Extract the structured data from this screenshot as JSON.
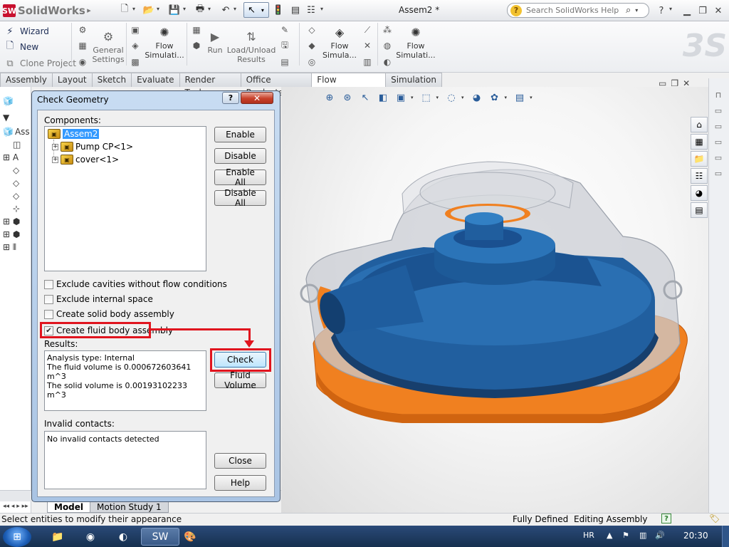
{
  "app": {
    "name": "SolidWorks",
    "document_title": "Assem2 *",
    "help_search_placeholder": "Search SolidWorks Help"
  },
  "command_manager": {
    "left_items": [
      {
        "label": "Wizard",
        "icon": "wizard-icon"
      },
      {
        "label": "New",
        "icon": "new-project-icon"
      },
      {
        "label": "Clone Project",
        "icon": "clone-project-icon"
      }
    ],
    "general_settings": "General Settings",
    "flow_simulation_1": "Flow Simulati...",
    "run": "Run",
    "load_unload_results": "Load/Unload Results",
    "flow_simulation_2": "Flow Simula...",
    "flow_simulation_3": "Flow Simulati..."
  },
  "tabs": [
    {
      "label": "Assembly",
      "active": false
    },
    {
      "label": "Layout",
      "active": false
    },
    {
      "label": "Sketch",
      "active": false
    },
    {
      "label": "Evaluate",
      "active": false
    },
    {
      "label": "Render Tools",
      "active": false
    },
    {
      "label": "Office Products",
      "active": false
    },
    {
      "label": "Flow Simulation",
      "active": true
    },
    {
      "label": "Simulation",
      "active": false
    }
  ],
  "feature_tree": {
    "top_item_partial": "Ass"
  },
  "dialog": {
    "title": "Check Geometry",
    "help_button": "?",
    "close_button": "✕",
    "components_label": "Components:",
    "tree": {
      "root": "Assem2",
      "children": [
        "Pump CP<1>",
        "cover<1>"
      ]
    },
    "buttons": {
      "enable": "Enable",
      "disable": "Disable",
      "enable_all": "Enable All",
      "disable_all": "Disable All",
      "check": "Check",
      "fluid_volume": "Fluid Volume",
      "close": "Close",
      "help": "Help"
    },
    "options": [
      {
        "label": "Exclude cavities without flow conditions",
        "checked": false
      },
      {
        "label": "Exclude internal space",
        "checked": false
      },
      {
        "label": "Create solid body assembly",
        "checked": false
      },
      {
        "label": "Create fluid body assembly",
        "checked": true
      }
    ],
    "results_label": "Results:",
    "results": [
      "Analysis type: Internal",
      "The fluid volume is 0.000672603641 m^3",
      "The solid volume is 0.00193102233 m^3"
    ],
    "invalid_contacts_label": "Invalid contacts:",
    "invalid_contacts": "No invalid contacts detected"
  },
  "bottom_tabs": {
    "model": "Model",
    "motion_study": "Motion Study 1"
  },
  "status_bar": {
    "message": "Select entities to modify their appearance",
    "definition": "Fully Defined",
    "mode": "Editing Assembly",
    "help_icon": "?"
  },
  "taskbar": {
    "language": "HR",
    "clock": "20:30"
  },
  "colors": {
    "accent_red": "#e0141e",
    "pump_blue": "#1f5d9e",
    "flange_orange": "#f08020",
    "selection_blue": "#3399ff"
  }
}
